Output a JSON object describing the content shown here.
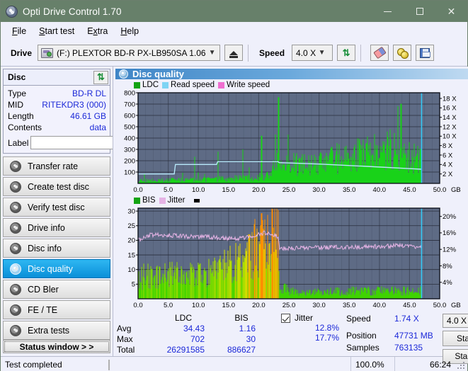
{
  "window": {
    "title": "Opti Drive Control 1.70",
    "icon": "disc-icon",
    "minimize": "—",
    "maximize": "□",
    "close": "✕"
  },
  "menu": {
    "items": [
      {
        "label": "File",
        "accel": "F"
      },
      {
        "label": "Start test",
        "accel": "S"
      },
      {
        "label": "Extra",
        "accel": "x"
      },
      {
        "label": "Help",
        "accel": "H"
      }
    ]
  },
  "toolbar": {
    "drive_label": "Drive",
    "drive_value": "(F:)  PLEXTOR BD-R  PX-LB950SA 1.06",
    "eject_button": "eject-icon",
    "speed_label": "Speed",
    "speed_value": "4.0 X",
    "refresh_button": "refresh-icon",
    "erase_button": "eraser-icon",
    "media_button": "media-icon",
    "save_button": "save-icon"
  },
  "disc": {
    "title": "Disc",
    "refresh_icon": "refresh-icon",
    "rows": [
      {
        "key": "Type",
        "value": "BD-R DL"
      },
      {
        "key": "MID",
        "value": "RITEKDR3 (000)"
      },
      {
        "key": "Length",
        "value": "46.61 GB"
      },
      {
        "key": "Contents",
        "value": "data"
      }
    ],
    "label_key": "Label",
    "label_value": "",
    "label_placeholder": "",
    "label_button": "cd-disc-icon"
  },
  "nav": {
    "items": [
      {
        "label": "Transfer rate",
        "active": false
      },
      {
        "label": "Create test disc",
        "active": false
      },
      {
        "label": "Verify test disc",
        "active": false
      },
      {
        "label": "Drive info",
        "active": false
      },
      {
        "label": "Disc info",
        "active": false
      },
      {
        "label": "Disc quality",
        "active": true
      },
      {
        "label": "CD Bler",
        "active": false
      },
      {
        "label": "FE / TE",
        "active": false
      },
      {
        "label": "Extra tests",
        "active": false
      }
    ],
    "status_window": "Status window > >"
  },
  "panel": {
    "title": "Disc quality",
    "icon": "disc-quality-icon"
  },
  "chart_data": [
    {
      "id": "top-chart",
      "type": "line",
      "title": "",
      "xlabel": "GB",
      "ylabel": "",
      "xlim": [
        0.0,
        50.0
      ],
      "xticks": [
        "0.0",
        "5.0",
        "10.0",
        "15.0",
        "20.0",
        "25.0",
        "30.0",
        "35.0",
        "40.0",
        "45.0",
        "50.0"
      ],
      "xtick_values": [
        0,
        5,
        10,
        15,
        20,
        25,
        30,
        35,
        40,
        45,
        50
      ],
      "x_unit": "GB",
      "ylim": [
        0,
        800
      ],
      "yticks": [
        "100",
        "200",
        "300",
        "400",
        "500",
        "600",
        "700",
        "800"
      ],
      "ytick_values": [
        100,
        200,
        300,
        400,
        500,
        600,
        700,
        800
      ],
      "y2lim": [
        0,
        19.2
      ],
      "y2ticks": [
        "2 X",
        "4 X",
        "6 X",
        "8 X",
        "10 X",
        "12 X",
        "14 X",
        "16 X",
        "18 X"
      ],
      "y2tick_values": [
        2,
        4,
        6,
        8,
        10,
        12,
        14,
        16,
        18
      ],
      "grid": true,
      "plot_bg": "#5e6b85",
      "legend_position": "top",
      "legend": [
        {
          "name": "LDC",
          "color": "#13a313"
        },
        {
          "name": "Read speed",
          "color": "#7fd4f4"
        },
        {
          "name": "Write speed",
          "color": "#ef6fd0"
        }
      ],
      "series": [
        {
          "name": "LDC",
          "color": "#19d219",
          "type": "impulse",
          "x_end": 47.0,
          "baseline": [
            {
              "x": 0,
              "y": 35
            },
            {
              "x": 5,
              "y": 40
            },
            {
              "x": 10,
              "y": 48
            },
            {
              "x": 15,
              "y": 58
            },
            {
              "x": 20,
              "y": 75
            },
            {
              "x": 22,
              "y": 120
            },
            {
              "x": 23.3,
              "y": 330
            },
            {
              "x": 24.5,
              "y": 250
            },
            {
              "x": 27,
              "y": 215
            },
            {
              "x": 30,
              "y": 250
            },
            {
              "x": 33,
              "y": 300
            },
            {
              "x": 36,
              "y": 330
            },
            {
              "x": 39,
              "y": 360
            },
            {
              "x": 41,
              "y": 400
            },
            {
              "x": 43,
              "y": 420
            },
            {
              "x": 44.5,
              "y": 350
            },
            {
              "x": 46,
              "y": 300
            },
            {
              "x": 47,
              "y": 260
            }
          ],
          "peaks": [
            {
              "x": 23.3,
              "y": 760
            },
            {
              "x": 43.6,
              "y": 702
            },
            {
              "x": 20.5,
              "y": 420
            },
            {
              "x": 17.4,
              "y": 300
            },
            {
              "x": 13.3,
              "y": 280
            },
            {
              "x": 9.4,
              "y": 235
            }
          ]
        },
        {
          "name": "Read speed",
          "color": "#7fd4f4",
          "type": "line",
          "points": [
            {
              "x": 0,
              "y": 2.0
            },
            {
              "x": 6.0,
              "y": 2.0
            },
            {
              "x": 6.2,
              "y": 4.0
            },
            {
              "x": 13.0,
              "y": 4.0
            },
            {
              "x": 13.2,
              "y": 4.6
            },
            {
              "x": 23.2,
              "y": 4.6
            },
            {
              "x": 23.4,
              "y": 4.4
            },
            {
              "x": 30.0,
              "y": 4.1
            },
            {
              "x": 38.0,
              "y": 3.6
            },
            {
              "x": 44.0,
              "y": 3.2
            },
            {
              "x": 47.0,
              "y": 3.0
            }
          ]
        },
        {
          "name": "Write speed",
          "color": "#ef6fd0",
          "type": "line",
          "points": []
        }
      ],
      "marker_line": {
        "x": 47.0,
        "color": "#35c8f5"
      }
    },
    {
      "id": "bottom-chart",
      "type": "line",
      "title": "",
      "xlabel": "GB",
      "xlim": [
        0.0,
        50.0
      ],
      "xticks": [
        "0.0",
        "5.0",
        "10.0",
        "15.0",
        "20.0",
        "25.0",
        "30.0",
        "35.0",
        "40.0",
        "45.0",
        "50.0"
      ],
      "xtick_values": [
        0,
        5,
        10,
        15,
        20,
        25,
        30,
        35,
        40,
        45,
        50
      ],
      "x_unit": "GB",
      "ylim": [
        0,
        31
      ],
      "yticks": [
        "5",
        "10",
        "15",
        "20",
        "25",
        "30"
      ],
      "ytick_values": [
        5,
        10,
        15,
        20,
        25,
        30
      ],
      "y2lim": [
        0,
        22
      ],
      "y2ticks": [
        "4%",
        "8%",
        "12%",
        "16%",
        "20%"
      ],
      "y2tick_values": [
        4,
        8,
        12,
        16,
        20
      ],
      "grid": true,
      "plot_bg": "#5e6b85",
      "legend_position": "top",
      "legend": [
        {
          "name": "BIS",
          "color": "#13a313"
        },
        {
          "name": "Jitter",
          "color": "#e5b3e5"
        }
      ],
      "series": [
        {
          "name": "BIS",
          "color": "#4fe000",
          "type": "impulse-gradient",
          "gradient": [
            "#3fd400",
            "#d8e000",
            "#ff8a00"
          ],
          "envelope": [
            {
              "x": 0,
              "y": 10
            },
            {
              "x": 3,
              "y": 10
            },
            {
              "x": 6,
              "y": 10.5
            },
            {
              "x": 9,
              "y": 11
            },
            {
              "x": 12,
              "y": 12
            },
            {
              "x": 14,
              "y": 14
            },
            {
              "x": 16,
              "y": 16
            },
            {
              "x": 18,
              "y": 19
            },
            {
              "x": 20,
              "y": 24
            },
            {
              "x": 21,
              "y": 27
            },
            {
              "x": 22,
              "y": 26
            },
            {
              "x": 23.2,
              "y": 30
            },
            {
              "x": 23.4,
              "y": 5
            },
            {
              "x": 26,
              "y": 3
            },
            {
              "x": 30,
              "y": 3
            },
            {
              "x": 35,
              "y": 3.5
            },
            {
              "x": 40,
              "y": 3.5
            },
            {
              "x": 45,
              "y": 3.5
            },
            {
              "x": 47,
              "y": 3.5
            }
          ]
        },
        {
          "name": "Jitter",
          "color": "#e5b3e5",
          "type": "line",
          "points": [
            {
              "x": 0,
              "y": 20.0
            },
            {
              "x": 2,
              "y": 21.8
            },
            {
              "x": 5,
              "y": 21.8
            },
            {
              "x": 8,
              "y": 21.3
            },
            {
              "x": 11,
              "y": 21.2
            },
            {
              "x": 14,
              "y": 20.8
            },
            {
              "x": 17,
              "y": 20.6
            },
            {
              "x": 19,
              "y": 21.4
            },
            {
              "x": 21,
              "y": 22.6
            },
            {
              "x": 22,
              "y": 22.3
            },
            {
              "x": 23.2,
              "y": 21.4
            },
            {
              "x": 23.5,
              "y": 17.2
            },
            {
              "x": 27,
              "y": 17.4
            },
            {
              "x": 31,
              "y": 17.6
            },
            {
              "x": 35,
              "y": 17.7
            },
            {
              "x": 39,
              "y": 17.8
            },
            {
              "x": 43,
              "y": 18.2
            },
            {
              "x": 46,
              "y": 17.9
            },
            {
              "x": 47,
              "y": 17.8
            }
          ]
        }
      ],
      "marker_line": {
        "x": 47.0,
        "color": "#35c8f5"
      }
    }
  ],
  "stats": {
    "columns": [
      "LDC",
      "BIS"
    ],
    "rows": [
      {
        "key": "Avg",
        "ldc": "34.43",
        "bis": "1.16",
        "jitter": "12.8%"
      },
      {
        "key": "Max",
        "ldc": "702",
        "bis": "30",
        "jitter": "17.7%"
      },
      {
        "key": "Total",
        "ldc": "26291585",
        "bis": "886627",
        "jitter": ""
      }
    ],
    "jitter_label": "Jitter",
    "jitter_checked": true,
    "speed_label": "Speed",
    "speed_value": "1.74 X",
    "position_label": "Position",
    "position_value": "47731 MB",
    "samples_label": "Samples",
    "samples_value": "763135",
    "speed_select": "4.0 X",
    "start_full": "Start full",
    "start_part": "Start part"
  },
  "statusbar": {
    "message": "Test completed",
    "progress_percent": "100.0%",
    "progress_value": 100,
    "elapsed": "66:24"
  }
}
